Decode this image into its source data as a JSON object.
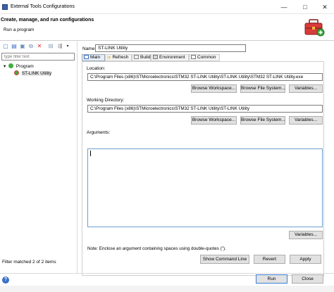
{
  "window": {
    "title": "External Tools Configurations",
    "minimize_glyph": "—",
    "maximize_glyph": "□",
    "close_glyph": "✕"
  },
  "header": {
    "title": "Create, manage, and run configurations",
    "subtitle": "Run a program"
  },
  "left": {
    "filter_placeholder": "type filter text",
    "tree": [
      {
        "label": "Program",
        "expander": "▾"
      },
      {
        "label": "ST-LINK Utility",
        "selected": true
      }
    ],
    "status": "Filter matched 2 of 2 items"
  },
  "config": {
    "name_label": "Name:",
    "name_value": "ST-LINK Utility",
    "tabs": [
      {
        "label": "Main",
        "active": true
      },
      {
        "label": "Refresh"
      },
      {
        "label": "Build"
      },
      {
        "label": "Environment"
      },
      {
        "label": "Common"
      }
    ],
    "location": {
      "label": "Location:",
      "value": "C:\\Program Files (x86)\\STMicroelectronics\\STM32 ST-LINK Utility\\ST-LINK Utility\\STM32 ST-LINK Utility.exe",
      "browse_workspace": "Browse Workspace...",
      "browse_file_system": "Browse File System...",
      "variables": "Variables..."
    },
    "working_directory": {
      "label": "Working Directory:",
      "value": "C:\\Program Files (x86)\\STMicroelectronics\\STM32 ST-LINK Utility\\ST-LINK Utility",
      "browse_workspace": "Browse Workspace...",
      "browse_file_system": "Browse File System...",
      "variables": "Variables..."
    },
    "arguments": {
      "label": "Arguments:",
      "value": "",
      "variables": "Variables...",
      "note": "Note: Enclose an argument containing spaces using double-quotes (\")."
    },
    "show_command_line": "Show Command Line",
    "revert": "Revert",
    "apply": "Apply"
  },
  "footer": {
    "help_glyph": "?",
    "run": "Run",
    "close": "Close"
  },
  "colors": {
    "accent": "#3c7fd2",
    "button_bg": "#e1e1e1",
    "toolbox_red": "#d93a3a"
  }
}
